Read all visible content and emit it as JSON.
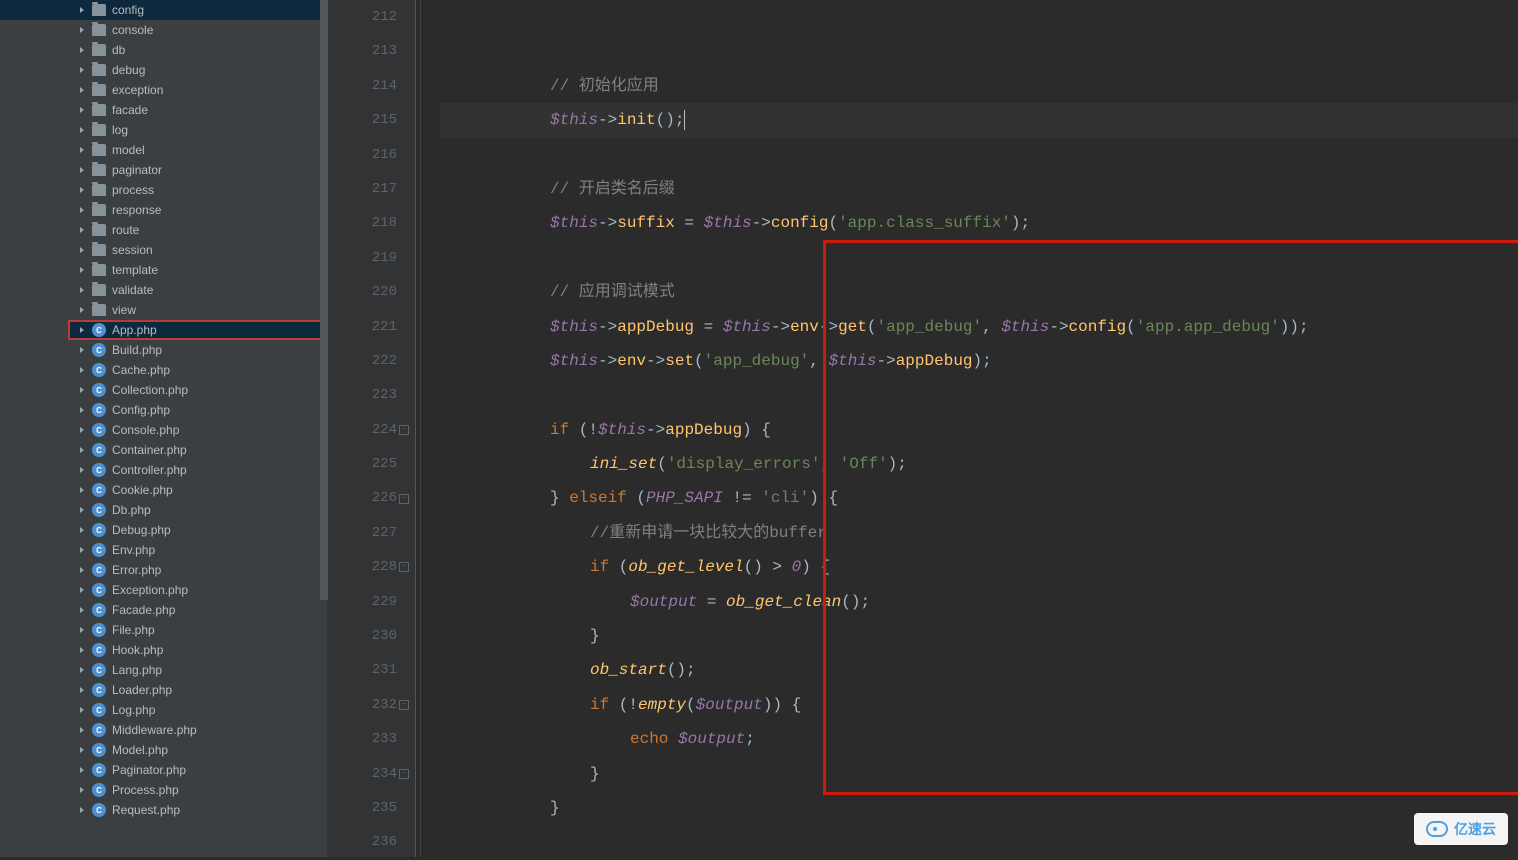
{
  "sidebar": {
    "folders": [
      {
        "name": "config"
      },
      {
        "name": "console"
      },
      {
        "name": "db"
      },
      {
        "name": "debug"
      },
      {
        "name": "exception"
      },
      {
        "name": "facade"
      },
      {
        "name": "log"
      },
      {
        "name": "model"
      },
      {
        "name": "paginator"
      },
      {
        "name": "process"
      },
      {
        "name": "response"
      },
      {
        "name": "route"
      },
      {
        "name": "session"
      },
      {
        "name": "template"
      },
      {
        "name": "validate"
      },
      {
        "name": "view"
      }
    ],
    "files": [
      {
        "name": "App.php",
        "selected": true
      },
      {
        "name": "Build.php"
      },
      {
        "name": "Cache.php"
      },
      {
        "name": "Collection.php"
      },
      {
        "name": "Config.php"
      },
      {
        "name": "Console.php"
      },
      {
        "name": "Container.php"
      },
      {
        "name": "Controller.php"
      },
      {
        "name": "Cookie.php"
      },
      {
        "name": "Db.php"
      },
      {
        "name": "Debug.php"
      },
      {
        "name": "Env.php"
      },
      {
        "name": "Error.php"
      },
      {
        "name": "Exception.php"
      },
      {
        "name": "Facade.php"
      },
      {
        "name": "File.php"
      },
      {
        "name": "Hook.php"
      },
      {
        "name": "Lang.php"
      },
      {
        "name": "Loader.php"
      },
      {
        "name": "Log.php"
      },
      {
        "name": "Middleware.php"
      },
      {
        "name": "Model.php"
      },
      {
        "name": "Paginator.php"
      },
      {
        "name": "Process.php"
      },
      {
        "name": "Request.php"
      }
    ]
  },
  "editor": {
    "start": 212,
    "end": 236,
    "tokens": {
      "l213": [
        {
          "t": "",
          "cls": "",
          "ind": 11
        }
      ],
      "l214": [
        {
          "t": "// 初始化应用",
          "cls": "c-comment",
          "ind": 11
        }
      ],
      "l215": [
        {
          "t": "$this",
          "cls": "c-this",
          "ind": 11
        },
        {
          "t": "->",
          "cls": "c-arrow"
        },
        {
          "t": "init",
          "cls": "c-method"
        },
        {
          "t": "();",
          "cls": "c-op"
        },
        {
          "t": "|",
          "cls": "cursor"
        }
      ],
      "l216": [
        {
          "t": "",
          "cls": "",
          "ind": 11
        }
      ],
      "l217": [
        {
          "t": "// 开启类名后缀",
          "cls": "c-comment",
          "ind": 11
        }
      ],
      "l218": [
        {
          "t": "$this",
          "cls": "c-this",
          "ind": 11
        },
        {
          "t": "->",
          "cls": "c-arrow"
        },
        {
          "t": "suffix",
          "cls": "c-method"
        },
        {
          "t": " = ",
          "cls": "c-op"
        },
        {
          "t": "$this",
          "cls": "c-this"
        },
        {
          "t": "->",
          "cls": "c-arrow"
        },
        {
          "t": "config",
          "cls": "c-method"
        },
        {
          "t": "(",
          "cls": "c-paren"
        },
        {
          "t": "'app.class_suffix'",
          "cls": "c-string"
        },
        {
          "t": ");",
          "cls": "c-op"
        }
      ],
      "l219": [
        {
          "t": "",
          "cls": "",
          "ind": 11
        }
      ],
      "l220": [
        {
          "t": "// 应用调试模式",
          "cls": "c-comment",
          "ind": 11
        }
      ],
      "l221": [
        {
          "t": "$this",
          "cls": "c-this",
          "ind": 11
        },
        {
          "t": "->",
          "cls": "c-arrow"
        },
        {
          "t": "appDebug",
          "cls": "c-method"
        },
        {
          "t": " = ",
          "cls": "c-op"
        },
        {
          "t": "$this",
          "cls": "c-this"
        },
        {
          "t": "->",
          "cls": "c-arrow"
        },
        {
          "t": "env",
          "cls": "c-method"
        },
        {
          "t": "->",
          "cls": "c-arrow"
        },
        {
          "t": "get",
          "cls": "c-method"
        },
        {
          "t": "(",
          "cls": "c-paren"
        },
        {
          "t": "'app_debug'",
          "cls": "c-string"
        },
        {
          "t": ", ",
          "cls": "c-op"
        },
        {
          "t": "$this",
          "cls": "c-this"
        },
        {
          "t": "->",
          "cls": "c-arrow"
        },
        {
          "t": "config",
          "cls": "c-method"
        },
        {
          "t": "(",
          "cls": "c-paren"
        },
        {
          "t": "'app.app_debug'",
          "cls": "c-string"
        },
        {
          "t": "));",
          "cls": "c-op"
        }
      ],
      "l222": [
        {
          "t": "$this",
          "cls": "c-this",
          "ind": 11
        },
        {
          "t": "->",
          "cls": "c-arrow"
        },
        {
          "t": "env",
          "cls": "c-method"
        },
        {
          "t": "->",
          "cls": "c-arrow"
        },
        {
          "t": "set",
          "cls": "c-method"
        },
        {
          "t": "(",
          "cls": "c-paren"
        },
        {
          "t": "'app_debug'",
          "cls": "c-string"
        },
        {
          "t": ", ",
          "cls": "c-op"
        },
        {
          "t": "$this",
          "cls": "c-this"
        },
        {
          "t": "->",
          "cls": "c-arrow"
        },
        {
          "t": "appDebug",
          "cls": "c-method"
        },
        {
          "t": ");",
          "cls": "c-op"
        }
      ],
      "l223": [
        {
          "t": "",
          "cls": "",
          "ind": 11
        }
      ],
      "l224": [
        {
          "t": "if",
          "cls": "c-keyword",
          "ind": 11
        },
        {
          "t": " (!",
          "cls": "c-op"
        },
        {
          "t": "$this",
          "cls": "c-this"
        },
        {
          "t": "->",
          "cls": "c-arrow"
        },
        {
          "t": "appDebug",
          "cls": "c-method"
        },
        {
          "t": ") {",
          "cls": "c-op"
        }
      ],
      "l225": [
        {
          "t": "ini_set",
          "cls": "c-func-ital",
          "ind": 15
        },
        {
          "t": "(",
          "cls": "c-paren"
        },
        {
          "t": "'display_errors'",
          "cls": "c-string"
        },
        {
          "t": ", ",
          "cls": "c-op"
        },
        {
          "t": "'Off'",
          "cls": "c-string"
        },
        {
          "t": ");",
          "cls": "c-op"
        }
      ],
      "l226": [
        {
          "t": "} ",
          "cls": "c-op",
          "ind": 11
        },
        {
          "t": "elseif",
          "cls": "c-keyword"
        },
        {
          "t": " (",
          "cls": "c-op"
        },
        {
          "t": "PHP_SAPI",
          "cls": "c-const"
        },
        {
          "t": " != ",
          "cls": "c-op"
        },
        {
          "t": "'cli'",
          "cls": "c-string"
        },
        {
          "t": ") {",
          "cls": "c-op"
        }
      ],
      "l227": [
        {
          "t": "//重新申请一块比较大的buffer",
          "cls": "c-comment",
          "ind": 15
        }
      ],
      "l228": [
        {
          "t": "if",
          "cls": "c-keyword",
          "ind": 15
        },
        {
          "t": " (",
          "cls": "c-op"
        },
        {
          "t": "ob_get_level",
          "cls": "c-func-ital"
        },
        {
          "t": "() > ",
          "cls": "c-op"
        },
        {
          "t": "0",
          "cls": "c-const"
        },
        {
          "t": ") {",
          "cls": "c-op"
        }
      ],
      "l229": [
        {
          "t": "$output",
          "cls": "c-var",
          "ind": 19
        },
        {
          "t": " = ",
          "cls": "c-op"
        },
        {
          "t": "ob_get_clean",
          "cls": "c-func-ital"
        },
        {
          "t": "();",
          "cls": "c-op"
        }
      ],
      "l230": [
        {
          "t": "}",
          "cls": "c-op",
          "ind": 15
        }
      ],
      "l231": [
        {
          "t": "ob_start",
          "cls": "c-func-ital",
          "ind": 15
        },
        {
          "t": "();",
          "cls": "c-op"
        }
      ],
      "l232": [
        {
          "t": "if",
          "cls": "c-keyword",
          "ind": 15
        },
        {
          "t": " (!",
          "cls": "c-op"
        },
        {
          "t": "empty",
          "cls": "c-func-ital"
        },
        {
          "t": "(",
          "cls": "c-paren"
        },
        {
          "t": "$output",
          "cls": "c-var"
        },
        {
          "t": ")) {",
          "cls": "c-op"
        }
      ],
      "l233": [
        {
          "t": "echo",
          "cls": "c-keyword",
          "ind": 19
        },
        {
          "t": " ",
          "cls": "c-op"
        },
        {
          "t": "$output",
          "cls": "c-var"
        },
        {
          "t": ";",
          "cls": "c-op"
        }
      ],
      "l234": [
        {
          "t": "}",
          "cls": "c-op",
          "ind": 15
        }
      ],
      "l235": [
        {
          "t": "}",
          "cls": "c-op",
          "ind": 11
        }
      ]
    },
    "fold_lines": [
      224,
      226,
      228,
      232,
      234
    ]
  },
  "watermark": "亿速云"
}
